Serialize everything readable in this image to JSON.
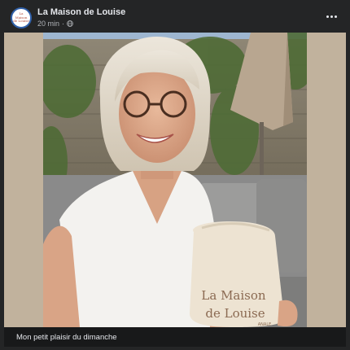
{
  "post": {
    "page_name": "La Maison de Louise",
    "time": "20 min",
    "separator": "·",
    "visibility_icon": "globe-icon",
    "more_icon": "more-horizontal-icon",
    "caption": "Mon petit plaisir du dimanche"
  },
  "avatar": {
    "logo_text": "La Maison de Louise"
  },
  "photo": {
    "bag_text_line1": "La Maison",
    "bag_text_line2": "de Louise",
    "bag_text_small": "ANALE"
  },
  "colors": {
    "card_bg": "#242526",
    "frame": "#c1b29d",
    "caption_bg": "#18191a",
    "text_primary": "#e4e6eb",
    "text_secondary": "#b0b3b8",
    "logo_ring": "#2f5fa8"
  }
}
